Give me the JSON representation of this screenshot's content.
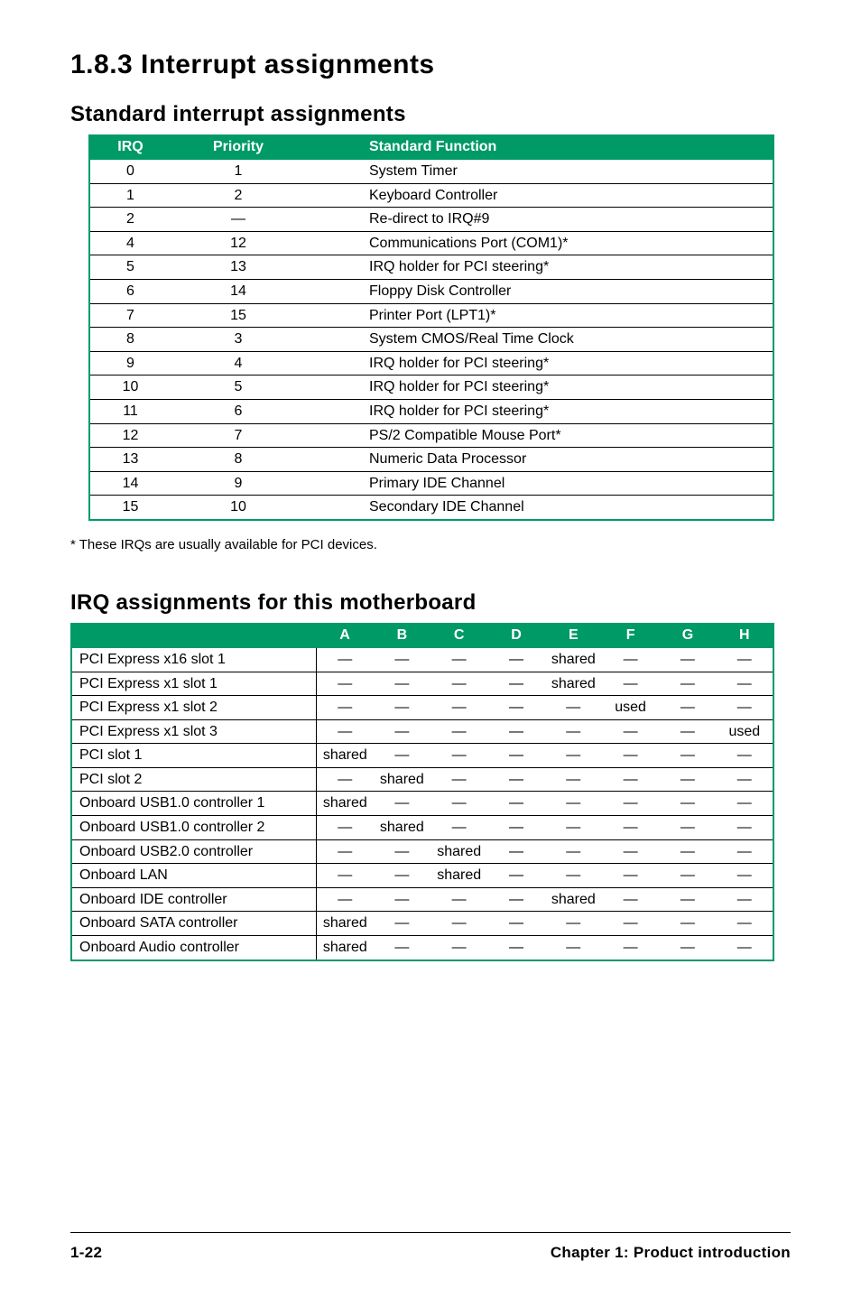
{
  "headings": {
    "section": "1.8.3   Interrupt assignments",
    "standard": "Standard interrupt assignments",
    "irq_heading": "IRQ assignments for this motherboard"
  },
  "std_table": {
    "headers": {
      "irq": "IRQ",
      "priority": "Priority",
      "fn": "Standard Function"
    },
    "rows": [
      {
        "irq": "0",
        "priority": "1",
        "fn": "System Timer"
      },
      {
        "irq": "1",
        "priority": "2",
        "fn": "Keyboard Controller"
      },
      {
        "irq": "2",
        "priority": "—",
        "fn": "Re-direct to IRQ#9"
      },
      {
        "irq": "4",
        "priority": "12",
        "fn": "Communications Port (COM1)*"
      },
      {
        "irq": "5",
        "priority": "13",
        "fn": "IRQ holder for PCI steering*"
      },
      {
        "irq": "6",
        "priority": "14",
        "fn": "Floppy Disk Controller"
      },
      {
        "irq": "7",
        "priority": "15",
        "fn": "Printer Port (LPT1)*"
      },
      {
        "irq": "8",
        "priority": "3",
        "fn": "System CMOS/Real Time Clock"
      },
      {
        "irq": "9",
        "priority": "4",
        "fn": "IRQ holder for PCI steering*"
      },
      {
        "irq": "10",
        "priority": "5",
        "fn": "IRQ holder for PCI steering*"
      },
      {
        "irq": "11",
        "priority": "6",
        "fn": "IRQ holder for PCI steering*"
      },
      {
        "irq": "12",
        "priority": "7",
        "fn": "PS/2 Compatible Mouse Port*"
      },
      {
        "irq": "13",
        "priority": "8",
        "fn": "Numeric Data Processor"
      },
      {
        "irq": "14",
        "priority": "9",
        "fn": "Primary IDE Channel"
      },
      {
        "irq": "15",
        "priority": "10",
        "fn": "Secondary IDE Channel"
      }
    ]
  },
  "footnote": "* These IRQs are usually available for PCI devices.",
  "irq_table": {
    "headers": [
      "A",
      "B",
      "C",
      "D",
      "E",
      "F",
      "G",
      "H"
    ],
    "rows": [
      {
        "name": "PCI Express x16 slot 1",
        "vals": [
          "—",
          "—",
          "—",
          "—",
          "shared",
          "—",
          "—",
          "—"
        ]
      },
      {
        "name": "PCI Express x1 slot 1",
        "vals": [
          "—",
          "—",
          "—",
          "—",
          "shared",
          "—",
          "—",
          "—"
        ]
      },
      {
        "name": "PCI Express x1 slot 2",
        "vals": [
          "—",
          "—",
          "—",
          "—",
          "—",
          "used",
          "—",
          "—"
        ]
      },
      {
        "name": "PCI Express x1 slot 3",
        "vals": [
          "—",
          "—",
          "—",
          "—",
          "—",
          "—",
          "—",
          "used"
        ]
      },
      {
        "name": "PCI slot 1",
        "vals": [
          "shared",
          "—",
          "—",
          "—",
          "—",
          "—",
          "—",
          "—"
        ]
      },
      {
        "name": "PCI slot 2",
        "vals": [
          "—",
          "shared",
          "—",
          "—",
          "—",
          "—",
          "—",
          "—"
        ]
      },
      {
        "name": "Onboard USB1.0 controller 1",
        "vals": [
          "shared",
          "—",
          "—",
          "—",
          "—",
          "—",
          "—",
          "—"
        ]
      },
      {
        "name": "Onboard USB1.0 controller 2",
        "vals": [
          "—",
          "shared",
          "—",
          "—",
          "—",
          "—",
          "—",
          "—"
        ]
      },
      {
        "name": "Onboard USB2.0 controller",
        "vals": [
          "—",
          "—",
          "shared",
          "—",
          "—",
          "—",
          "—",
          "—"
        ]
      },
      {
        "name": "Onboard LAN",
        "vals": [
          "—",
          "—",
          "shared",
          "—",
          "—",
          "—",
          "—",
          "—"
        ]
      },
      {
        "name": "Onboard IDE controller",
        "vals": [
          "—",
          "—",
          "—",
          "—",
          "shared",
          "—",
          "—",
          "—"
        ]
      },
      {
        "name": "Onboard SATA controller",
        "vals": [
          "shared",
          "—",
          "—",
          "—",
          "—",
          "—",
          "—",
          "—"
        ]
      },
      {
        "name": "Onboard Audio controller",
        "vals": [
          "shared",
          "—",
          "—",
          "—",
          "—",
          "—",
          "—",
          "—"
        ]
      }
    ]
  },
  "footer": {
    "left": "1-22",
    "right": "Chapter 1: Product introduction"
  }
}
